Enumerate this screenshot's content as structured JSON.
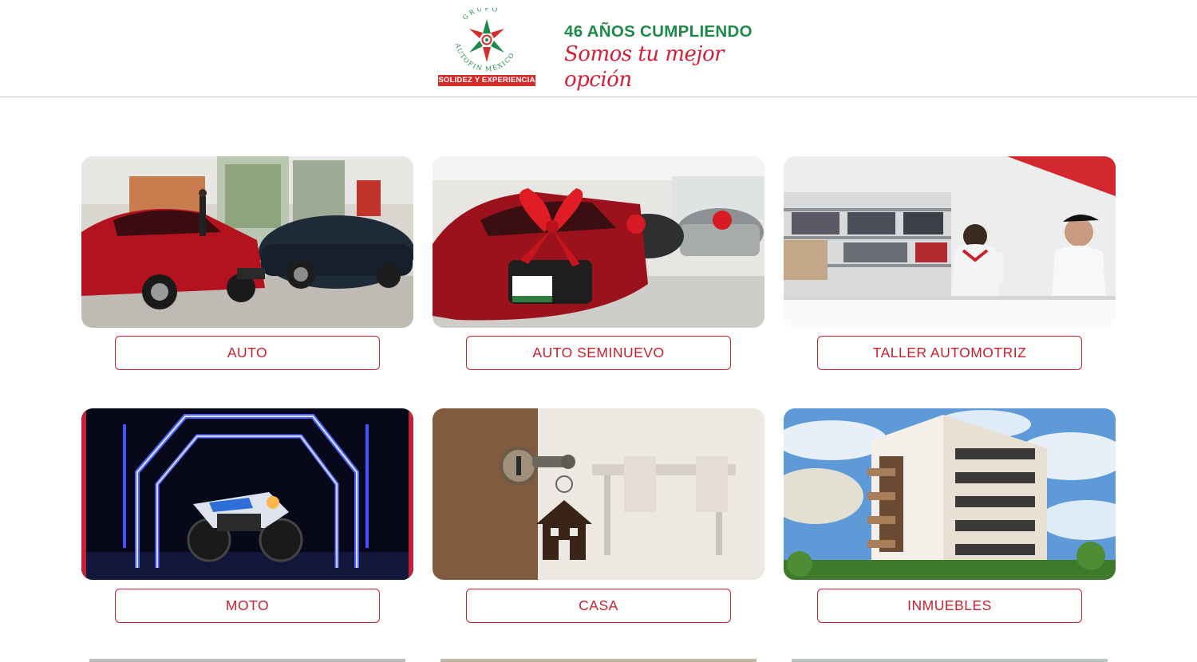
{
  "header": {
    "logo_arc_text": "GRUPO AUTOFIN MÉXICO",
    "logo_badge": "SOLIDEZ Y EXPERIENCIA",
    "slogan_top": "46 AÑOS CUMPLIENDO",
    "slogan_script": "Somos tu mejor opción"
  },
  "colors": {
    "brand_red": "#c9202e",
    "brand_green": "#1e8a4a"
  },
  "products": [
    {
      "label": "AUTO",
      "image": "showroom-cars-image"
    },
    {
      "label": "AUTO SEMINUEVO",
      "image": "car-with-bow-image"
    },
    {
      "label": "TALLER AUTOMOTRIZ",
      "image": "auto-parts-counter-image"
    },
    {
      "label": "MOTO",
      "image": "motorcycle-neon-image"
    },
    {
      "label": "CASA",
      "image": "house-key-image"
    },
    {
      "label": "INMUEBLES",
      "image": "apartment-building-image"
    }
  ]
}
